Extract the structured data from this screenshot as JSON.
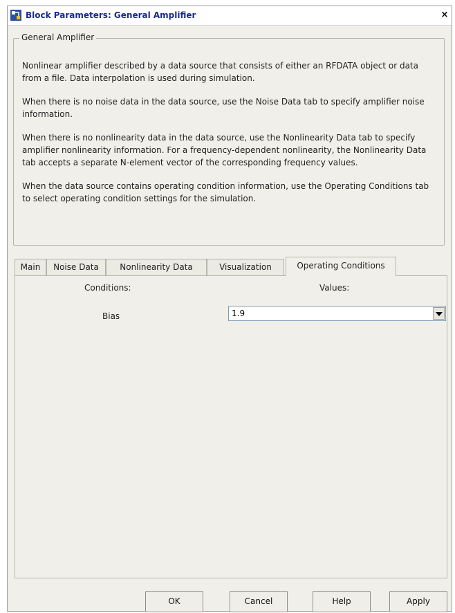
{
  "window": {
    "title": "Block Parameters: General Amplifier",
    "close_symbol": "×"
  },
  "group": {
    "legend": "General Amplifier",
    "paragraphs": [
      "Nonlinear amplifier described by a data source that consists of either an RFDATA object or data from a file. Data interpolation is used during simulation.",
      "When there is no noise data in the data source, use the Noise Data tab to specify amplifier noise information.",
      "When there is no nonlinearity data in the data source, use the Nonlinearity Data tab to specify amplifier nonlinearity information. For a frequency-dependent nonlinearity, the Nonlinearity Data tab accepts a separate N-element vector of the corresponding frequency values.",
      "When the data source contains operating condition information, use the Operating Conditions tab to select operating condition settings for the simulation."
    ]
  },
  "tabs": [
    {
      "label": "Main"
    },
    {
      "label": "Noise Data"
    },
    {
      "label": "Nonlinearity Data"
    },
    {
      "label": "Visualization"
    },
    {
      "label": "Operating Conditions"
    }
  ],
  "active_tab": "Operating Conditions",
  "panel": {
    "conditions_header": "Conditions:",
    "values_header": "Values:",
    "rows": [
      {
        "condition": "Bias",
        "value": "1.9"
      }
    ]
  },
  "buttons": {
    "ok": "OK",
    "cancel": "Cancel",
    "help": "Help",
    "apply": "Apply"
  },
  "icons": {
    "title": "simulink-block-icon",
    "close": "close-icon",
    "dropdown": "chevron-down-icon"
  }
}
